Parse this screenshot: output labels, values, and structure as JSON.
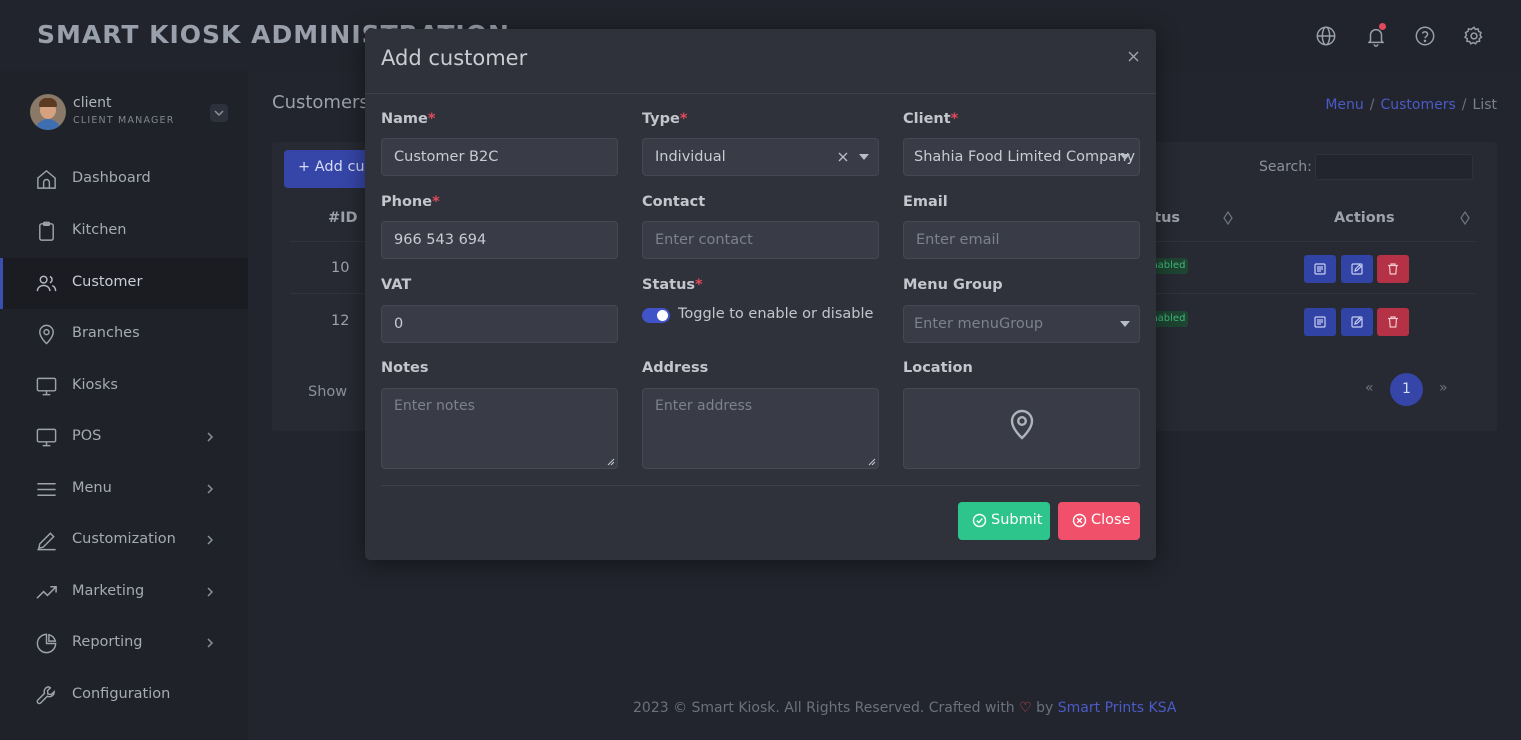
{
  "app": {
    "title": "SMART KIOSK ADMINISTRATION"
  },
  "header_icons": [
    "globe-icon",
    "bell-icon",
    "help-icon",
    "gear-icon"
  ],
  "user": {
    "name": "client",
    "role": "CLIENT MANAGER"
  },
  "sidebar": {
    "items": [
      {
        "label": "Dashboard",
        "icon": "home-icon",
        "has_submenu": false,
        "active": false
      },
      {
        "label": "Kitchen",
        "icon": "clipboard-icon",
        "has_submenu": false,
        "active": false
      },
      {
        "label": "Customer",
        "icon": "users-icon",
        "has_submenu": false,
        "active": true
      },
      {
        "label": "Branches",
        "icon": "map-pin-icon",
        "has_submenu": false,
        "active": false
      },
      {
        "label": "Kiosks",
        "icon": "monitor-icon",
        "has_submenu": false,
        "active": false
      },
      {
        "label": "POS",
        "icon": "monitor-icon",
        "has_submenu": true,
        "active": false
      },
      {
        "label": "Menu",
        "icon": "menu-icon",
        "has_submenu": true,
        "active": false
      },
      {
        "label": "Customization",
        "icon": "pen-icon",
        "has_submenu": true,
        "active": false
      },
      {
        "label": "Marketing",
        "icon": "trending-up-icon",
        "has_submenu": true,
        "active": false
      },
      {
        "label": "Reporting",
        "icon": "pie-chart-icon",
        "has_submenu": true,
        "active": false
      },
      {
        "label": "Configuration",
        "icon": "wrench-icon",
        "has_submenu": false,
        "active": false
      }
    ]
  },
  "page": {
    "title": "Customers",
    "breadcrumb": {
      "items": [
        "Menu",
        "Customers",
        "List"
      ],
      "separator": "/"
    },
    "add_button": "+ Add customer",
    "search_label": "Search:",
    "table": {
      "headers": {
        "id": "#ID",
        "status": "Status",
        "actions": "Actions"
      },
      "rows": [
        {
          "id": "10",
          "status": "Enabled"
        },
        {
          "id": "12",
          "status": "Enabled"
        }
      ]
    },
    "show_label": "Show",
    "pagination": {
      "prev": "«",
      "current": "1",
      "next": "»"
    }
  },
  "footer": {
    "text": "2023 © Smart Kiosk. All Rights Reserved. Crafted with",
    "heart": "♡",
    "by": "by",
    "link": "Smart Prints KSA"
  },
  "modal": {
    "title": "Add customer",
    "fields": {
      "name": {
        "label": "Name",
        "required": "*",
        "value": "Customer B2C"
      },
      "type": {
        "label": "Type",
        "required": "*",
        "value": "Individual"
      },
      "client": {
        "label": "Client",
        "required": "*",
        "value": "Shahia Food Limited Company"
      },
      "phone": {
        "label": "Phone",
        "required": "*",
        "value": "966 543 694"
      },
      "contact": {
        "label": "Contact",
        "placeholder": "Enter contact"
      },
      "email": {
        "label": "Email",
        "placeholder": "Enter email"
      },
      "vat": {
        "label": "VAT",
        "value": "0"
      },
      "status": {
        "label": "Status",
        "required": "*",
        "toggle_text": "Toggle to enable or disable",
        "enabled": true
      },
      "menu_group": {
        "label": "Menu Group",
        "placeholder": "Enter menuGroup"
      },
      "notes": {
        "label": "Notes",
        "placeholder": "Enter notes"
      },
      "address": {
        "label": "Address",
        "placeholder": "Enter address"
      },
      "location": {
        "label": "Location"
      }
    },
    "buttons": {
      "submit": "Submit",
      "close": "Close"
    }
  },
  "colors": {
    "accent": "#3646a8",
    "submit": "#2ec58c",
    "close": "#f0506a",
    "required": "#e24a5a",
    "status_badge": "#42b97a"
  }
}
